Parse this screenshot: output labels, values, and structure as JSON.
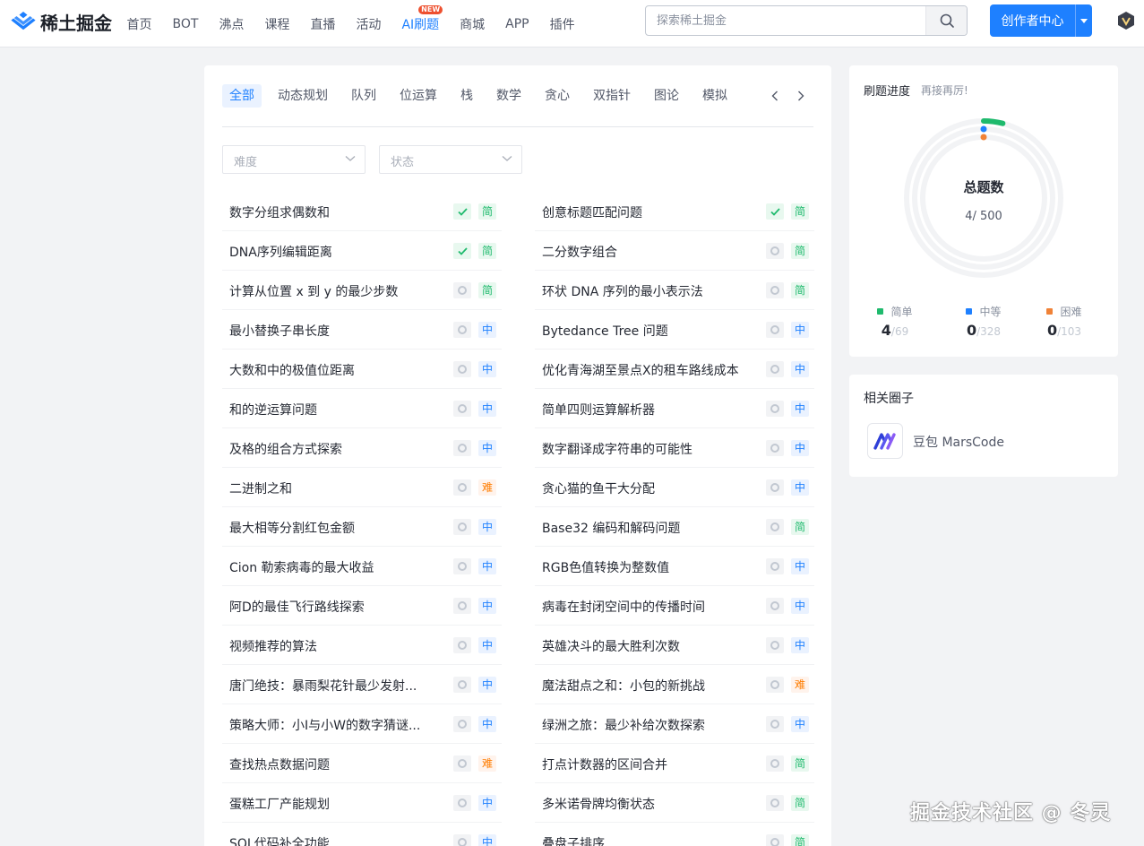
{
  "header": {
    "logo_text": "稀土掘金",
    "nav": [
      {
        "label": "首页"
      },
      {
        "label": "BOT"
      },
      {
        "label": "沸点"
      },
      {
        "label": "课程"
      },
      {
        "label": "直播"
      },
      {
        "label": "活动"
      },
      {
        "label": "AI刷题",
        "active": true,
        "badge": "NEW"
      },
      {
        "label": "商城"
      },
      {
        "label": "APP"
      },
      {
        "label": "插件"
      }
    ],
    "search_placeholder": "探索稀土掘金",
    "creator_label": "创作者中心"
  },
  "tabs": [
    "全部",
    "动态规划",
    "队列",
    "位运算",
    "栈",
    "数学",
    "贪心",
    "双指针",
    "图论",
    "模拟"
  ],
  "filters": {
    "difficulty_placeholder": "难度",
    "status_placeholder": "状态"
  },
  "difficulty_labels": {
    "easy": "简",
    "medium": "中",
    "hard": "难"
  },
  "problems_left": [
    {
      "title": "数字分组求偶数和",
      "done": true,
      "level": "easy"
    },
    {
      "title": "DNA序列编辑距离",
      "done": true,
      "level": "easy"
    },
    {
      "title": "计算从位置 x 到 y 的最少步数",
      "done": false,
      "level": "easy"
    },
    {
      "title": "最小替换子串长度",
      "done": false,
      "level": "medium"
    },
    {
      "title": "大数和中的极值位距离",
      "done": false,
      "level": "medium"
    },
    {
      "title": "和的逆运算问题",
      "done": false,
      "level": "medium"
    },
    {
      "title": "及格的组合方式探索",
      "done": false,
      "level": "medium"
    },
    {
      "title": "二进制之和",
      "done": false,
      "level": "hard"
    },
    {
      "title": "最大相等分割红包金额",
      "done": false,
      "level": "medium"
    },
    {
      "title": "Cion 勒索病毒的最大收益",
      "done": false,
      "level": "medium"
    },
    {
      "title": "阿D的最佳飞行路线探索",
      "done": false,
      "level": "medium"
    },
    {
      "title": "视频推荐的算法",
      "done": false,
      "level": "medium"
    },
    {
      "title": "唐门绝技：暴雨梨花针最少发射...",
      "done": false,
      "level": "medium"
    },
    {
      "title": "策略大师：小I与小W的数字猜谜...",
      "done": false,
      "level": "medium"
    },
    {
      "title": "查找热点数据问题",
      "done": false,
      "level": "hard"
    },
    {
      "title": "蛋糕工厂产能规划",
      "done": false,
      "level": "medium"
    },
    {
      "title": "SQL代码补全功能",
      "done": false,
      "level": "medium"
    }
  ],
  "problems_right": [
    {
      "title": "创意标题匹配问题",
      "done": true,
      "level": "easy"
    },
    {
      "title": "二分数字组合",
      "done": false,
      "level": "easy"
    },
    {
      "title": "环状 DNA 序列的最小表示法",
      "done": false,
      "level": "easy"
    },
    {
      "title": "Bytedance Tree 问题",
      "done": false,
      "level": "medium"
    },
    {
      "title": "优化青海湖至景点X的租车路线成本",
      "done": false,
      "level": "medium"
    },
    {
      "title": "简单四则运算解析器",
      "done": false,
      "level": "medium"
    },
    {
      "title": "数字翻译成字符串的可能性",
      "done": false,
      "level": "medium"
    },
    {
      "title": "贪心猫的鱼干大分配",
      "done": false,
      "level": "medium"
    },
    {
      "title": "Base32 编码和解码问题",
      "done": false,
      "level": "easy"
    },
    {
      "title": "RGB色值转换为整数值",
      "done": false,
      "level": "medium"
    },
    {
      "title": "病毒在封闭空间中的传播时间",
      "done": false,
      "level": "medium"
    },
    {
      "title": "英雄决斗的最大胜利次数",
      "done": false,
      "level": "medium"
    },
    {
      "title": "魔法甜点之和：小包的新挑战",
      "done": false,
      "level": "hard"
    },
    {
      "title": "绿洲之旅：最少补给次数探索",
      "done": false,
      "level": "medium"
    },
    {
      "title": "打点计数器的区间合并",
      "done": false,
      "level": "easy"
    },
    {
      "title": "多米诺骨牌均衡状态",
      "done": false,
      "level": "easy"
    },
    {
      "title": "叠盘子排序",
      "done": false,
      "level": "easy"
    }
  ],
  "progress": {
    "title": "刷题进度",
    "subtitle": "再接再厉!",
    "center_title": "总题数",
    "count_text": "4/ 500",
    "solved": 4,
    "total": 500,
    "legend": [
      {
        "label": "简单",
        "value": "4",
        "total": "/69",
        "color": "#1fba6d"
      },
      {
        "label": "中等",
        "value": "0",
        "total": "/328",
        "color": "#1e80ff"
      },
      {
        "label": "困难",
        "value": "0",
        "total": "/103",
        "color": "#f08237"
      }
    ]
  },
  "circle": {
    "title": "相关圈子",
    "name": "豆包 MarsCode"
  },
  "watermark": "掘金技术社区 @ 冬灵",
  "colors": {
    "accent": "#1e80ff",
    "easy": "#1fba6d",
    "medium": "#1e80ff",
    "hard": "#ff7d00"
  }
}
